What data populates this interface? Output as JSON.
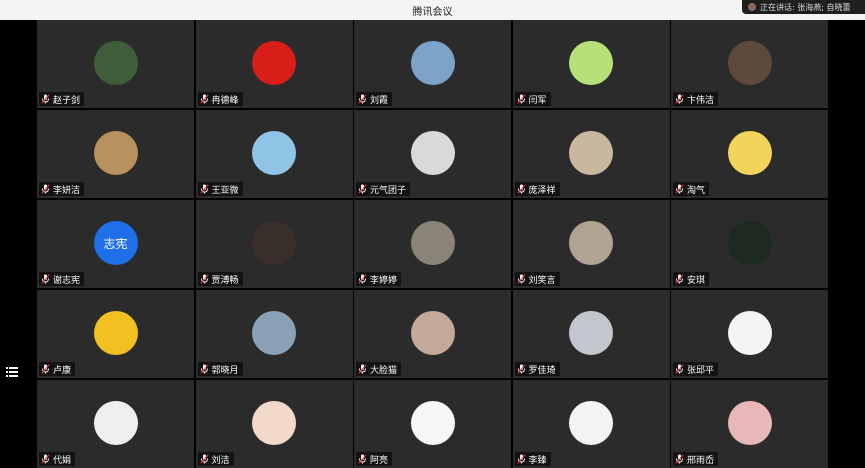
{
  "window": {
    "title": "腾讯会议"
  },
  "speaking_indicator": {
    "text": "正在讲话: 张海燕; 自晓蕾"
  },
  "participants": [
    {
      "name": "赵子剑",
      "avatar_text": "",
      "avatar_color": "#3f5d38"
    },
    {
      "name": "冉德峰",
      "avatar_text": "",
      "avatar_color": "#d81e18"
    },
    {
      "name": "刘霞",
      "avatar_text": "",
      "avatar_color": "#7ea3c9"
    },
    {
      "name": "闫军",
      "avatar_text": "",
      "avatar_color": "#b8e07a"
    },
    {
      "name": "卞伟洁",
      "avatar_text": "",
      "avatar_color": "#5d4a3c"
    },
    {
      "name": "李妍洁",
      "avatar_text": "",
      "avatar_color": "#b8925e"
    },
    {
      "name": "王亚微",
      "avatar_text": "",
      "avatar_color": "#8fc4e6"
    },
    {
      "name": "元气团子",
      "avatar_text": "",
      "avatar_color": "#d9d9d9"
    },
    {
      "name": "庞泽祥",
      "avatar_text": "",
      "avatar_color": "#c9b7a0"
    },
    {
      "name": "淘气",
      "avatar_text": "",
      "avatar_color": "#f2d45c"
    },
    {
      "name": "谢志宪",
      "avatar_text": "志宪",
      "avatar_color": "#1e6fe8"
    },
    {
      "name": "贾溥畅",
      "avatar_text": "",
      "avatar_color": "#3a2e2a"
    },
    {
      "name": "李婷婷",
      "avatar_text": "",
      "avatar_color": "#8a8378"
    },
    {
      "name": "刘笑言",
      "avatar_text": "",
      "avatar_color": "#b0a394"
    },
    {
      "name": "安琪",
      "avatar_text": "",
      "avatar_color": "#1c2a22"
    },
    {
      "name": "卢康",
      "avatar_text": "",
      "avatar_color": "#f3c021"
    },
    {
      "name": "郭晓月",
      "avatar_text": "",
      "avatar_color": "#8aa0b5"
    },
    {
      "name": "大脸猫",
      "avatar_text": "",
      "avatar_color": "#c4a89a"
    },
    {
      "name": "罗佳琦",
      "avatar_text": "",
      "avatar_color": "#c3c6cc"
    },
    {
      "name": "张邱平",
      "avatar_text": "",
      "avatar_color": "#f4f4f4"
    },
    {
      "name": "代娟",
      "avatar_text": "",
      "avatar_color": "#efefef"
    },
    {
      "name": "刘洁",
      "avatar_text": "",
      "avatar_color": "#f2d9c9"
    },
    {
      "name": "阿亮",
      "avatar_text": "",
      "avatar_color": "#f7f7f7"
    },
    {
      "name": "李臻",
      "avatar_text": "",
      "avatar_color": "#f3f3f3"
    },
    {
      "name": "邢雨岙",
      "avatar_text": "",
      "avatar_color": "#e8b7b7"
    }
  ],
  "icons": {
    "mic": "mic-muted-icon",
    "menu": "list-menu-icon"
  }
}
